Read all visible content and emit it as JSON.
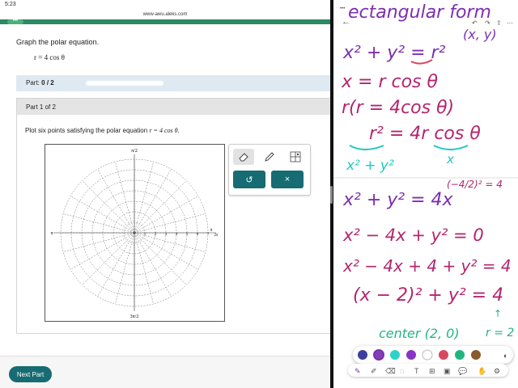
{
  "status": {
    "time": "5:23",
    "url": "www-awu.aleks.com"
  },
  "question": {
    "title": "Graph the polar equation.",
    "equation": "r = 4 cos θ"
  },
  "partbar": {
    "label": "Part:",
    "progress": "0 / 2"
  },
  "part": {
    "header": "Part 1 of 2",
    "instruction_prefix": "Plot six points satisfying the polar equation",
    "instruction_eq": "r = 4 cos θ."
  },
  "graph": {
    "label_pi_over_2": "π/2",
    "label_pi": "π",
    "label_0": "0",
    "label_2pi": "2π",
    "label_3pi_over_2": "3π/2",
    "radial_labels": [
      "1",
      "2",
      "3",
      "4",
      "5",
      "6",
      "7"
    ]
  },
  "tools": {
    "undo_glyph": "↺",
    "clear_glyph": "×"
  },
  "footer": {
    "next_label": "Next Part"
  },
  "notes": {
    "lines": [
      "ectangular form",
      "(x, y)",
      "x² + y² = r²",
      "x = r cos θ",
      "r(r = 4cos θ)",
      "r² = 4r cos θ",
      "x² + y²",
      "x",
      "x² + y² = 4x",
      "(−4/2)² = 4",
      "x² − 4x + y² = 0",
      "x² − 4x + 4 + y² = 4",
      "(x − 2)² + y² = 4",
      "center (2, 0)",
      "r = 2"
    ]
  },
  "palette": {
    "colors": [
      "#3b3f9e",
      "#7e3fb8",
      "#2ed3c8",
      "#8a33c9",
      "#ffffff",
      "#d9485f",
      "#23b57f",
      "#8a5a2b"
    ]
  },
  "colors": {
    "teal": "#176b72",
    "green_brand": "#2a8a63",
    "pen_purple": "#7d2fae",
    "pen_cyan": "#1fc7c0",
    "pen_magenta": "#b3266e"
  }
}
